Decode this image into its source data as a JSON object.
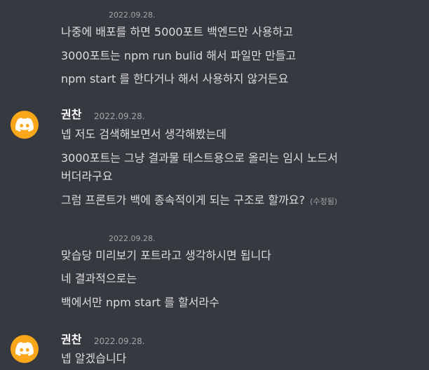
{
  "colors": {
    "background": "#36393f",
    "text": "#dcddde",
    "muted": "#a3a6aa",
    "author": "#ffffff",
    "avatar_bg": "#faa61a"
  },
  "groups": [
    {
      "timestamp": "2022.09.28.",
      "lines": [
        "나중에 배포를 하면 5000포트 백엔드만 사용하고",
        "3000포트는 npm run bulid 해서 파일만 만들고",
        "npm start 를 한다거나 해서 사용하지 않거든요"
      ]
    },
    {
      "author": "권찬",
      "avatar_icon": "discord-logo-icon",
      "timestamp": "2022.09.28.",
      "lines": [
        "넵 저도 검색해보면서 생각해봤는데",
        "3000포트는 그냥 결과물 테스트용으로 올리는 임시 노드서",
        "버더라구요",
        "그럼 프론트가 백에 종속적이게 되는 구조로 할까요?"
      ],
      "edited_label": "(수정됨)"
    },
    {
      "timestamp": "2022.09.28.",
      "lines": [
        "맞습당 미리보기 포트라고 생각하시면 됩니다",
        "네 결과적으로는",
        "백에서만 npm start 를 할서라수"
      ]
    },
    {
      "author": "권찬",
      "avatar_icon": "discord-logo-icon",
      "timestamp": "2022.09.28.",
      "lines": [
        "넵 알겠습니다"
      ]
    }
  ]
}
